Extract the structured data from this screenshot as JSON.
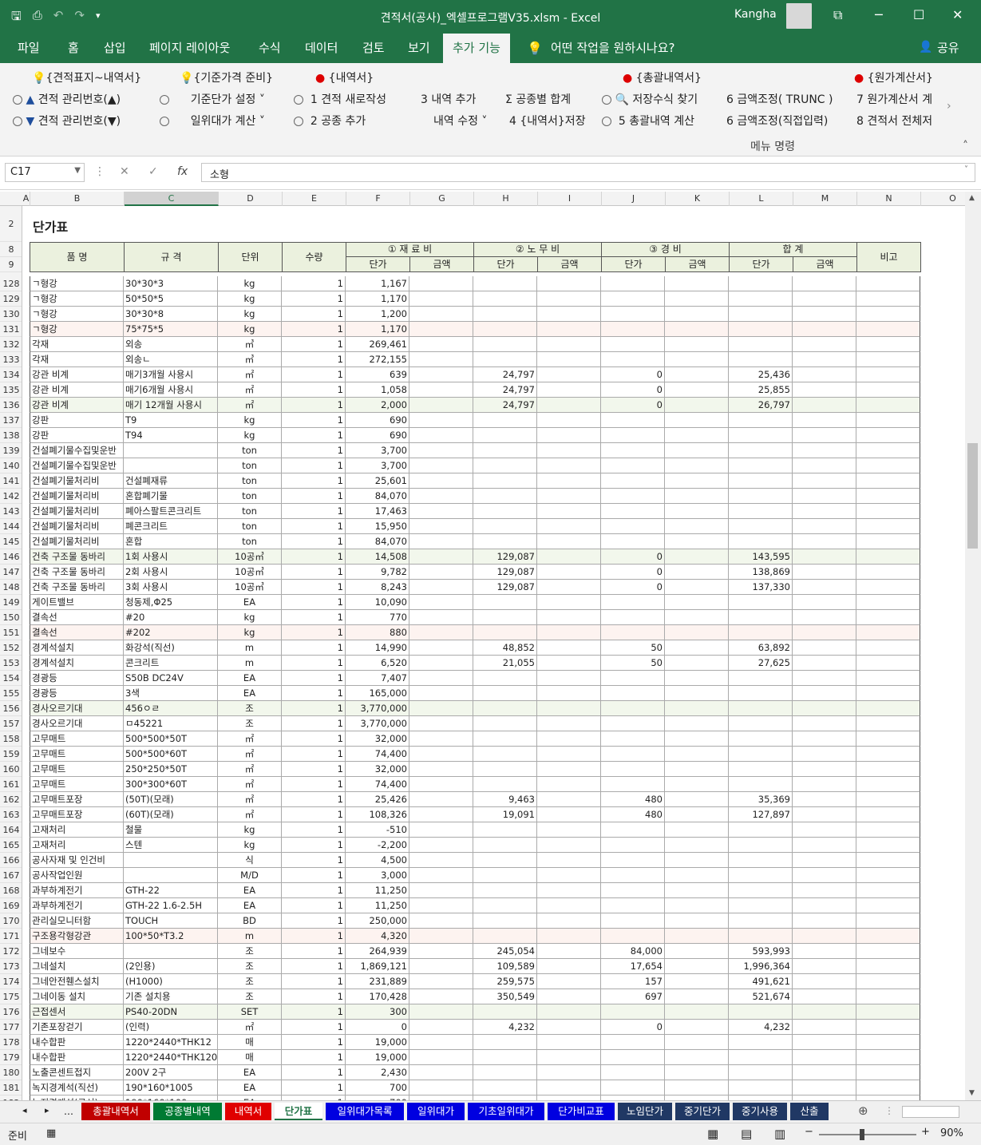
{
  "window": {
    "title": "견적서(공사)_엑셀프로그램V35.xlsm  -  Excel",
    "user": "Kangha"
  },
  "tabs": [
    "파일",
    "홈",
    "삽입",
    "페이지 레이아웃",
    "수식",
    "데이터",
    "검토",
    "보기",
    "추가 기능",
    "어떤 작업을 원하시나요?",
    "공유"
  ],
  "ribbon": {
    "r1": [
      "{견적표지~내역서}",
      "{기준가격 준비}",
      "{내역서}",
      "{총괄내역서}",
      "{원가계산서}"
    ],
    "r2": [
      "견적 관리번호(▲)",
      "기준단가 설정",
      "1  견적 새로작성",
      "3  내역 추가",
      "공종별 합계",
      "저장수식 찾기",
      "6  금액조정( TRUNC )",
      "7  원가계산서 계"
    ],
    "r3": [
      "견적 관리번호(▼)",
      "일위대가 계산",
      "2  공종 추가",
      "내역 수정",
      "4  {내역서}저장",
      "5  총괄내역 계산",
      "6  금액조정(직접입력)",
      "8  견적서 전체저"
    ],
    "group_label": "메뉴 명령"
  },
  "formula_bar": {
    "name_box": "C17",
    "formula": "소형",
    "fx": "fx"
  },
  "columns": [
    "A",
    "B",
    "C",
    "D",
    "E",
    "F",
    "G",
    "H",
    "I",
    "J",
    "K",
    "L",
    "M",
    "N",
    "O"
  ],
  "sheet": {
    "title": "단가표",
    "header": {
      "name": "품      명",
      "spec": "규   격",
      "unit": "단위",
      "qty": "수량",
      "mat": "① 재 료 비",
      "lab": "② 노 무 비",
      "exp": "③ 경   비",
      "sum": "합    계",
      "note": "비고",
      "unit_price": "단가",
      "amount": "금액"
    },
    "hdr_rows": [
      "2",
      "8",
      "9"
    ],
    "rows": [
      [
        "128",
        "ㄱ형강",
        "30*30*3",
        "kg",
        "1",
        "1,167",
        "",
        "",
        "",
        "",
        ""
      ],
      [
        "129",
        "ㄱ형강",
        "50*50*5",
        "kg",
        "1",
        "1,170",
        "",
        "",
        "",
        "",
        ""
      ],
      [
        "130",
        "ㄱ형강",
        "30*30*8",
        "kg",
        "1",
        "1,200",
        "",
        "",
        "",
        "",
        ""
      ],
      [
        "131",
        "ㄱ형강",
        "75*75*5",
        "kg",
        "1",
        "1,170",
        "",
        "",
        "",
        "",
        ""
      ],
      [
        "132",
        "각재",
        "외송",
        "㎥",
        "1",
        "269,461",
        "",
        "",
        "",
        "",
        ""
      ],
      [
        "133",
        "각재",
        "외송ㄴ",
        "㎥",
        "1",
        "272,155",
        "",
        "",
        "",
        "",
        ""
      ],
      [
        "134",
        "강관 비계",
        "매기3개월 사용시",
        "㎡",
        "1",
        "639",
        "24,797",
        "",
        "0",
        "",
        "25,436"
      ],
      [
        "135",
        "강관 비계",
        "매기6개월 사용시",
        "㎡",
        "1",
        "1,058",
        "24,797",
        "",
        "0",
        "",
        "25,855"
      ],
      [
        "136",
        "강관 비계",
        "매기 12개월 사용시",
        "㎡",
        "1",
        "2,000",
        "24,797",
        "",
        "0",
        "",
        "26,797"
      ],
      [
        "137",
        "강판",
        "T9",
        "kg",
        "1",
        "690",
        "",
        "",
        "",
        "",
        ""
      ],
      [
        "138",
        "강판",
        "T94",
        "kg",
        "1",
        "690",
        "",
        "",
        "",
        "",
        ""
      ],
      [
        "139",
        "건설폐기물수집및운반",
        "",
        "ton",
        "1",
        "3,700",
        "",
        "",
        "",
        "",
        ""
      ],
      [
        "140",
        "건설폐기물수집및운반",
        "",
        "ton",
        "1",
        "3,700",
        "",
        "",
        "",
        "",
        ""
      ],
      [
        "141",
        "건설폐기물처리비",
        "건설폐재류",
        "ton",
        "1",
        "25,601",
        "",
        "",
        "",
        "",
        ""
      ],
      [
        "142",
        "건설폐기물처리비",
        "혼합폐기물",
        "ton",
        "1",
        "84,070",
        "",
        "",
        "",
        "",
        ""
      ],
      [
        "143",
        "건설폐기물처리비",
        "폐아스팔트콘크리트",
        "ton",
        "1",
        "17,463",
        "",
        "",
        "",
        "",
        ""
      ],
      [
        "144",
        "건설폐기물처리비",
        "폐콘크리트",
        "ton",
        "1",
        "15,950",
        "",
        "",
        "",
        "",
        ""
      ],
      [
        "145",
        "건설폐기물처리비",
        "혼합",
        "ton",
        "1",
        "84,070",
        "",
        "",
        "",
        "",
        ""
      ],
      [
        "146",
        "건축 구조물 동바리",
        "1회 사용시",
        "10공㎥",
        "1",
        "14,508",
        "129,087",
        "",
        "0",
        "",
        "143,595"
      ],
      [
        "147",
        "건축 구조물 동바리",
        "2회 사용시",
        "10공㎥",
        "1",
        "9,782",
        "129,087",
        "",
        "0",
        "",
        "138,869"
      ],
      [
        "148",
        "건축 구조물 동바리",
        "3회 사용시",
        "10공㎥",
        "1",
        "8,243",
        "129,087",
        "",
        "0",
        "",
        "137,330"
      ],
      [
        "149",
        "게이트밸브",
        "청동제,Φ25",
        "EA",
        "1",
        "10,090",
        "",
        "",
        "",
        "",
        ""
      ],
      [
        "150",
        "결속선",
        "#20",
        "kg",
        "1",
        "770",
        "",
        "",
        "",
        "",
        ""
      ],
      [
        "151",
        "결속선",
        "#202",
        "kg",
        "1",
        "880",
        "",
        "",
        "",
        "",
        ""
      ],
      [
        "152",
        "경계석설치",
        "화강석(직선)",
        "m",
        "1",
        "14,990",
        "48,852",
        "",
        "50",
        "",
        "63,892"
      ],
      [
        "153",
        "경계석설치",
        "콘크리트",
        "m",
        "1",
        "6,520",
        "21,055",
        "",
        "50",
        "",
        "27,625"
      ],
      [
        "154",
        "경광등",
        "S50B DC24V",
        "EA",
        "1",
        "7,407",
        "",
        "",
        "",
        "",
        ""
      ],
      [
        "155",
        "경광등",
        "3색",
        "EA",
        "1",
        "165,000",
        "",
        "",
        "",
        "",
        ""
      ],
      [
        "156",
        "경사오르기대",
        "456ㅇㄹ",
        "조",
        "1",
        "3,770,000",
        "",
        "",
        "",
        "",
        ""
      ],
      [
        "157",
        "경사오르기대",
        "ㅁ45221",
        "조",
        "1",
        "3,770,000",
        "",
        "",
        "",
        "",
        ""
      ],
      [
        "158",
        "고무매트",
        "500*500*50T",
        "㎡",
        "1",
        "32,000",
        "",
        "",
        "",
        "",
        ""
      ],
      [
        "159",
        "고무매트",
        "500*500*60T",
        "㎡",
        "1",
        "74,400",
        "",
        "",
        "",
        "",
        ""
      ],
      [
        "160",
        "고무매트",
        "250*250*50T",
        "㎡",
        "1",
        "32,000",
        "",
        "",
        "",
        "",
        ""
      ],
      [
        "161",
        "고무매트",
        "300*300*60T",
        "㎡",
        "1",
        "74,400",
        "",
        "",
        "",
        "",
        ""
      ],
      [
        "162",
        "고무매트포장",
        "(50T)(모래)",
        "㎡",
        "1",
        "25,426",
        "9,463",
        "",
        "480",
        "",
        "35,369"
      ],
      [
        "163",
        "고무매트포장",
        "(60T)(모래)",
        "㎡",
        "1",
        "108,326",
        "19,091",
        "",
        "480",
        "",
        "127,897"
      ],
      [
        "164",
        "고재처리",
        "철물",
        "kg",
        "1",
        "-510",
        "",
        "",
        "",
        "",
        ""
      ],
      [
        "165",
        "고재처리",
        "스텐",
        "kg",
        "1",
        "-2,200",
        "",
        "",
        "",
        "",
        ""
      ],
      [
        "166",
        "공사자재 및 인건비",
        "",
        "식",
        "1",
        "4,500",
        "",
        "",
        "",
        "",
        ""
      ],
      [
        "167",
        "공사작업인원",
        "",
        "M/D",
        "1",
        "3,000",
        "",
        "",
        "",
        "",
        ""
      ],
      [
        "168",
        "과부하계전기",
        "GTH-22",
        "EA",
        "1",
        "11,250",
        "",
        "",
        "",
        "",
        ""
      ],
      [
        "169",
        "과부하계전기",
        "GTH-22 1.6-2.5H",
        "EA",
        "1",
        "11,250",
        "",
        "",
        "",
        "",
        ""
      ],
      [
        "170",
        "관리실모니터함",
        "TOUCH",
        "BD",
        "1",
        "250,000",
        "",
        "",
        "",
        "",
        ""
      ],
      [
        "171",
        "구조용각형강관",
        "100*50*T3.2",
        "m",
        "1",
        "4,320",
        "",
        "",
        "",
        "",
        ""
      ],
      [
        "172",
        "그네보수",
        "",
        "조",
        "1",
        "264,939",
        "245,054",
        "",
        "84,000",
        "",
        "593,993"
      ],
      [
        "173",
        "그네설치",
        "(2인용)",
        "조",
        "1",
        "1,869,121",
        "109,589",
        "",
        "17,654",
        "",
        "1,996,364"
      ],
      [
        "174",
        "그네안전휀스설치",
        "(H1000)",
        "조",
        "1",
        "231,889",
        "259,575",
        "",
        "157",
        "",
        "491,621"
      ],
      [
        "175",
        "그네이동 설치",
        "기존 설치용",
        "조",
        "1",
        "170,428",
        "350,549",
        "",
        "697",
        "",
        "521,674"
      ],
      [
        "176",
        "근접센서",
        "PS40-20DN",
        "SET",
        "1",
        "300",
        "",
        "",
        "",
        "",
        ""
      ],
      [
        "177",
        "기존포장걷기",
        "(인력)",
        "㎡",
        "1",
        "0",
        "4,232",
        "",
        "0",
        "",
        "4,232"
      ],
      [
        "178",
        "내수합판",
        "1220*2440*THK12",
        "매",
        "1",
        "19,000",
        "",
        "",
        "",
        "",
        ""
      ],
      [
        "179",
        "내수합판",
        "1220*2440*THK120",
        "매",
        "1",
        "19,000",
        "",
        "",
        "",
        "",
        ""
      ],
      [
        "180",
        "노출콘센트접지",
        "200V 2구",
        "EA",
        "1",
        "2,430",
        "",
        "",
        "",
        "",
        ""
      ],
      [
        "181",
        "녹지경계석(직선)",
        "190*160*1005",
        "EA",
        "1",
        "700",
        "",
        "",
        "",
        "",
        ""
      ],
      [
        "182",
        "녹지경계석(곡선)",
        "190*160*100",
        "EA",
        "1",
        "700",
        "",
        "",
        "",
        "",
        ""
      ]
    ]
  },
  "sheet_tabs": [
    "...",
    "총괄내역서",
    "공종별내역",
    "내역서",
    "단가표",
    "일위대가목록",
    "일위대가",
    "기초일위대가",
    "단가비교표",
    "노임단가",
    "중기단가",
    "중기사용",
    "산출"
  ],
  "status": {
    "ready": "준비",
    "zoom": "90%"
  }
}
